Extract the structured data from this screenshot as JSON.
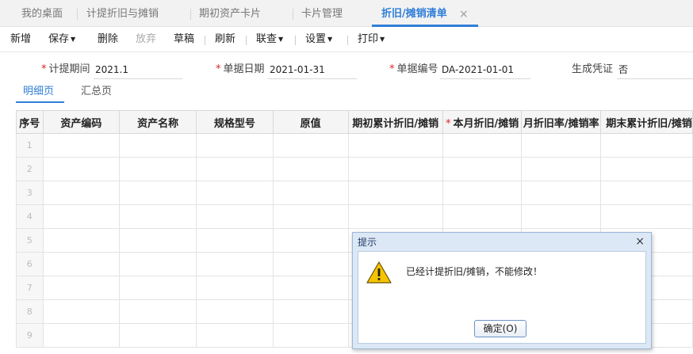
{
  "tabs": [
    {
      "label": "我的桌面"
    },
    {
      "label": "计提折旧与摊销"
    },
    {
      "label": "期初资产卡片"
    },
    {
      "label": "卡片管理"
    },
    {
      "label": "折旧/摊销清单"
    }
  ],
  "active_tab": "折旧/摊销清单",
  "tab_close_icon": "×",
  "toolbar": {
    "new": "新增",
    "save": "保存",
    "delete": "删除",
    "discard": "放弃",
    "draft": "草稿",
    "refresh": "刷新",
    "linked_query": "联查",
    "settings": "设置",
    "print": "打印"
  },
  "form": {
    "period_label": "计提期间",
    "period_value": "2021.1",
    "date_label": "单据日期",
    "date_value": "2021-01-31",
    "doc_no_label": "单据编号",
    "doc_no_value": "DA-2021-01-01",
    "voucher_label": "生成凭证",
    "voucher_value": "否"
  },
  "subtabs": {
    "detail": "明细页",
    "summary": "汇总页"
  },
  "table": {
    "columns": [
      "序号",
      "资产编码",
      "资产名称",
      "规格型号",
      "原值",
      "期初累计折旧/摊销",
      "本月折旧/摊销",
      "月折旧率/摊销率",
      "期末累计折旧/摊销"
    ],
    "rows": [
      "1",
      "2",
      "3",
      "4",
      "5",
      "6",
      "7",
      "8",
      "9"
    ]
  },
  "dialog": {
    "title": "提示",
    "message": "已经计提折旧/摊销，不能修改！",
    "ok_button": "确定(O)",
    "close_icon": "×",
    "icon": "warning-icon"
  },
  "colors": {
    "accent": "#2f7ed8",
    "required": "#e02020",
    "dialog_frame": "#dce8f5"
  }
}
